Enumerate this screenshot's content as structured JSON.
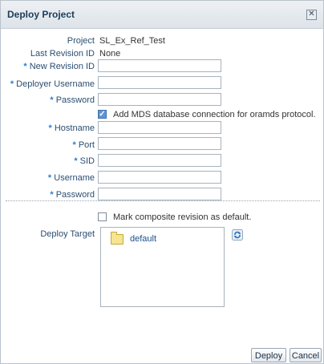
{
  "dialog": {
    "title": "Deploy Project",
    "close_glyph": "✕"
  },
  "fields": {
    "project_label": "Project",
    "project_value": "SL_Ex_Ref_Test",
    "last_revision_label": "Last Revision ID",
    "last_revision_value": "None",
    "new_revision_label": "New Revision ID",
    "new_revision_value": "",
    "deployer_username_label": "Deployer Username",
    "deployer_username_value": "",
    "password_label": "Password",
    "password_value": "",
    "add_mds_label": "Add MDS database connection for oramds protocol.",
    "add_mds_checked": true,
    "hostname_label": "Hostname",
    "hostname_value": "",
    "port_label": "Port",
    "port_value": "",
    "sid_label": "SID",
    "sid_value": "",
    "db_username_label": "Username",
    "db_username_value": "",
    "db_password_label": "Password",
    "db_password_value": "",
    "mark_default_label": "Mark composite revision as default.",
    "mark_default_checked": false,
    "required_marker": "*"
  },
  "deploy_target": {
    "label": "Deploy Target",
    "items": [
      "default"
    ],
    "refresh_icon": "refresh-icon"
  },
  "buttons": {
    "deploy": "Deploy",
    "cancel": "Cancel"
  },
  "colors": {
    "label": "#2b4e72",
    "required": "#2a7fd4",
    "checkbox_checked": "#5c95d6",
    "title": "#1c3d5a"
  }
}
